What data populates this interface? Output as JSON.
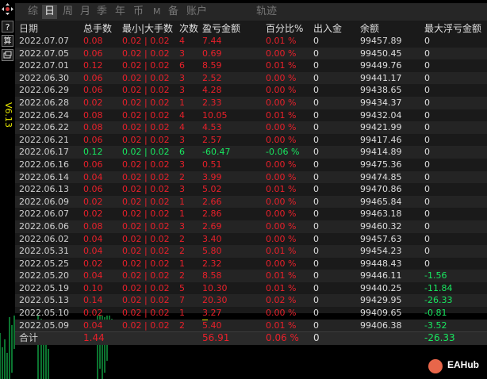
{
  "toolbar": {
    "version": "V6.13",
    "icons": [
      "crosshair-icon",
      "help-icon",
      "calculator-icon",
      "window-icon"
    ],
    "help_label": "?",
    "calc_label": "算"
  },
  "tabs": [
    {
      "label": "综",
      "active": false
    },
    {
      "label": "日",
      "active": true
    },
    {
      "label": "周",
      "active": false
    },
    {
      "label": "月",
      "active": false
    },
    {
      "label": "季",
      "active": false
    },
    {
      "label": "年",
      "active": false
    },
    {
      "label": "币",
      "active": false
    },
    {
      "label": "M",
      "active": false
    },
    {
      "label": "备",
      "active": false
    },
    {
      "label": "账户",
      "active": false
    },
    {
      "label": "轨迹",
      "active": false
    }
  ],
  "table": {
    "headers": {
      "date": "日期",
      "lots": "总手数",
      "minmax": "最小|大手数",
      "count": "次数",
      "pl": "盈亏金额",
      "pct": "百分比%",
      "io": "出入金",
      "balance": "余额",
      "dd": "最大浮亏金额"
    },
    "rows": [
      {
        "date": "2022.07.07",
        "lots": "0.08",
        "minmax": "0.02 | 0.02",
        "count": "4",
        "pl": "7.44",
        "pct": "0.01 %",
        "io": "0",
        "balance": "99457.89",
        "dd": "0",
        "sign": "red"
      },
      {
        "date": "2022.07.05",
        "lots": "0.06",
        "minmax": "0.02 | 0.02",
        "count": "3",
        "pl": "0.69",
        "pct": "0.00 %",
        "io": "0",
        "balance": "99450.45",
        "dd": "0",
        "sign": "red"
      },
      {
        "date": "2022.07.01",
        "lots": "0.12",
        "minmax": "0.02 | 0.02",
        "count": "6",
        "pl": "8.59",
        "pct": "0.01 %",
        "io": "0",
        "balance": "99449.76",
        "dd": "0",
        "sign": "red"
      },
      {
        "date": "2022.06.30",
        "lots": "0.06",
        "minmax": "0.02 | 0.02",
        "count": "3",
        "pl": "2.52",
        "pct": "0.00 %",
        "io": "0",
        "balance": "99441.17",
        "dd": "0",
        "sign": "red"
      },
      {
        "date": "2022.06.29",
        "lots": "0.06",
        "minmax": "0.02 | 0.02",
        "count": "3",
        "pl": "4.28",
        "pct": "0.00 %",
        "io": "0",
        "balance": "99438.65",
        "dd": "0",
        "sign": "red"
      },
      {
        "date": "2022.06.28",
        "lots": "0.02",
        "minmax": "0.02 | 0.02",
        "count": "1",
        "pl": "2.33",
        "pct": "0.00 %",
        "io": "0",
        "balance": "99434.37",
        "dd": "0",
        "sign": "red"
      },
      {
        "date": "2022.06.24",
        "lots": "0.08",
        "minmax": "0.02 | 0.02",
        "count": "4",
        "pl": "10.05",
        "pct": "0.01 %",
        "io": "0",
        "balance": "99432.04",
        "dd": "0",
        "sign": "red"
      },
      {
        "date": "2022.06.22",
        "lots": "0.08",
        "minmax": "0.02 | 0.02",
        "count": "4",
        "pl": "4.53",
        "pct": "0.00 %",
        "io": "0",
        "balance": "99421.99",
        "dd": "0",
        "sign": "red"
      },
      {
        "date": "2022.06.21",
        "lots": "0.06",
        "minmax": "0.02 | 0.02",
        "count": "3",
        "pl": "2.57",
        "pct": "0.00 %",
        "io": "0",
        "balance": "99417.46",
        "dd": "0",
        "sign": "red"
      },
      {
        "date": "2022.06.17",
        "lots": "0.12",
        "minmax": "0.02 | 0.02",
        "count": "6",
        "pl": "-60.47",
        "pct": "-0.06 %",
        "io": "0",
        "balance": "99414.89",
        "dd": "0",
        "sign": "green"
      },
      {
        "date": "2022.06.16",
        "lots": "0.06",
        "minmax": "0.02 | 0.02",
        "count": "3",
        "pl": "0.51",
        "pct": "0.00 %",
        "io": "0",
        "balance": "99475.36",
        "dd": "0",
        "sign": "red"
      },
      {
        "date": "2022.06.14",
        "lots": "0.04",
        "minmax": "0.02 | 0.02",
        "count": "2",
        "pl": "3.99",
        "pct": "0.00 %",
        "io": "0",
        "balance": "99474.85",
        "dd": "0",
        "sign": "red"
      },
      {
        "date": "2022.06.13",
        "lots": "0.06",
        "minmax": "0.02 | 0.02",
        "count": "3",
        "pl": "5.02",
        "pct": "0.01 %",
        "io": "0",
        "balance": "99470.86",
        "dd": "0",
        "sign": "red"
      },
      {
        "date": "2022.06.09",
        "lots": "0.02",
        "minmax": "0.02 | 0.02",
        "count": "1",
        "pl": "2.66",
        "pct": "0.00 %",
        "io": "0",
        "balance": "99465.84",
        "dd": "0",
        "sign": "red"
      },
      {
        "date": "2022.06.07",
        "lots": "0.02",
        "minmax": "0.02 | 0.02",
        "count": "1",
        "pl": "2.86",
        "pct": "0.00 %",
        "io": "0",
        "balance": "99463.18",
        "dd": "0",
        "sign": "red"
      },
      {
        "date": "2022.06.06",
        "lots": "0.08",
        "minmax": "0.02 | 0.02",
        "count": "3",
        "pl": "2.69",
        "pct": "0.00 %",
        "io": "0",
        "balance": "99460.32",
        "dd": "0",
        "sign": "red"
      },
      {
        "date": "2022.06.02",
        "lots": "0.04",
        "minmax": "0.02 | 0.02",
        "count": "2",
        "pl": "3.40",
        "pct": "0.00 %",
        "io": "0",
        "balance": "99457.63",
        "dd": "0",
        "sign": "red"
      },
      {
        "date": "2022.05.31",
        "lots": "0.04",
        "minmax": "0.02 | 0.02",
        "count": "2",
        "pl": "5.80",
        "pct": "0.01 %",
        "io": "0",
        "balance": "99454.23",
        "dd": "0",
        "sign": "red"
      },
      {
        "date": "2022.05.25",
        "lots": "0.02",
        "minmax": "0.02 | 0.02",
        "count": "1",
        "pl": "2.32",
        "pct": "0.00 %",
        "io": "0",
        "balance": "99448.43",
        "dd": "0",
        "sign": "red"
      },
      {
        "date": "2022.05.20",
        "lots": "0.04",
        "minmax": "0.02 | 0.02",
        "count": "2",
        "pl": "8.58",
        "pct": "0.01 %",
        "io": "0",
        "balance": "99446.11",
        "dd": "-1.56",
        "sign": "red"
      },
      {
        "date": "2022.05.19",
        "lots": "0.10",
        "minmax": "0.02 | 0.02",
        "count": "5",
        "pl": "10.30",
        "pct": "0.01 %",
        "io": "0",
        "balance": "99440.25",
        "dd": "-11.84",
        "sign": "red"
      },
      {
        "date": "2022.05.13",
        "lots": "0.14",
        "minmax": "0.02 | 0.02",
        "count": "7",
        "pl": "20.30",
        "pct": "0.02 %",
        "io": "0",
        "balance": "99429.95",
        "dd": "-26.33",
        "sign": "red"
      },
      {
        "date": "2022.05.10",
        "lots": "0.02",
        "minmax": "0.02 | 0.02",
        "count": "1",
        "pl": "3.27",
        "pct": "0.00 %",
        "io": "0",
        "balance": "99409.65",
        "dd": "-0.81",
        "sign": "red"
      },
      {
        "date": "2022.05.09",
        "lots": "0.04",
        "minmax": "0.02 | 0.02",
        "count": "2",
        "pl": "5.40",
        "pct": "0.01 %",
        "io": "0",
        "balance": "99406.38",
        "dd": "-3.52",
        "sign": "red"
      }
    ],
    "total": {
      "label": "合计",
      "lots": "1.44",
      "pl": "56.91",
      "pct": "0.06 %",
      "io": "0",
      "dd": "-26.33"
    }
  },
  "brand": {
    "name": "EAHub"
  },
  "colors": {
    "positive": "#e8202a",
    "negative": "#18e860",
    "accent": "#e8e800",
    "panel": "#1a1a1a"
  }
}
